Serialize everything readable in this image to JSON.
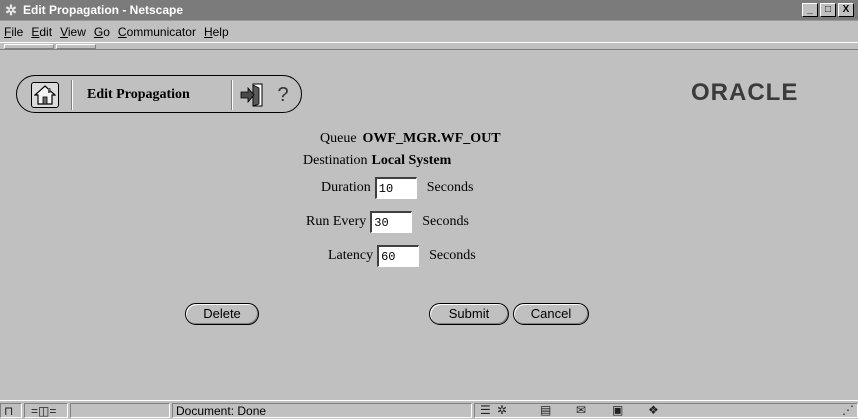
{
  "window": {
    "title": "Edit Propagation - Netscape",
    "controls": {
      "minimize": "_",
      "maximize": "□",
      "close": "X"
    }
  },
  "menubar": {
    "items": [
      {
        "label": "File",
        "mnemonic": "F"
      },
      {
        "label": "Edit",
        "mnemonic": "E"
      },
      {
        "label": "View",
        "mnemonic": "V"
      },
      {
        "label": "Go",
        "mnemonic": "G"
      },
      {
        "label": "Communicator",
        "mnemonic": "C"
      },
      {
        "label": "Help",
        "mnemonic": "H"
      }
    ]
  },
  "header": {
    "page_title": "Edit Propagation",
    "help_glyph": "?",
    "logo_text": "ORACLE",
    "icons": [
      "home-icon",
      "exit-icon",
      "help-icon"
    ]
  },
  "form": {
    "queue_label": "Queue",
    "queue_value": "OWF_MGR.WF_OUT",
    "destination_label": "Destination",
    "destination_value": "Local System",
    "duration_label": "Duration",
    "duration_value": "10",
    "run_every_label": "Run Every",
    "run_every_value": "30",
    "latency_label": "Latency",
    "latency_value": "60",
    "unit": "Seconds"
  },
  "actions": {
    "delete_label": "Delete",
    "submit_label": "Submit",
    "cancel_label": "Cancel"
  },
  "statusbar": {
    "status_text": "Document: Done"
  }
}
